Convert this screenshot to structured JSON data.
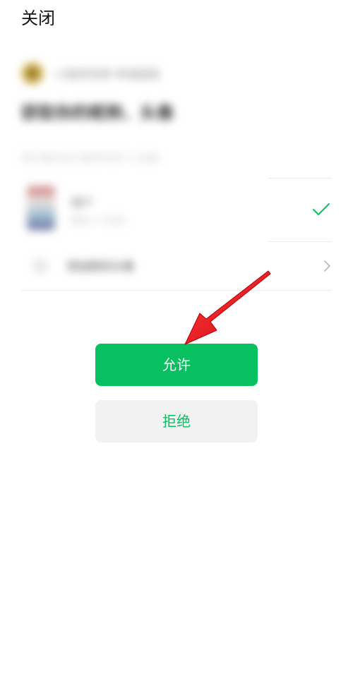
{
  "header": {
    "close_label": "关闭"
  },
  "redacted": {
    "app_name": "小程序名称 申请授权",
    "request_title": "获取你的昵称、头像",
    "request_desc": "用于展示在小程序中的个人信息",
    "account_name": "用户",
    "account_sub": "微信个人信息",
    "add_label": "添加新的头像"
  },
  "actions": {
    "allow_label": "允许",
    "deny_label": "拒绝"
  },
  "colors": {
    "accent_green": "#07c160",
    "annotation_red": "#e8141c"
  },
  "icons": {
    "selected": "checkmark-icon",
    "more": "chevron-right-icon",
    "annotation": "red-arrow-icon"
  }
}
